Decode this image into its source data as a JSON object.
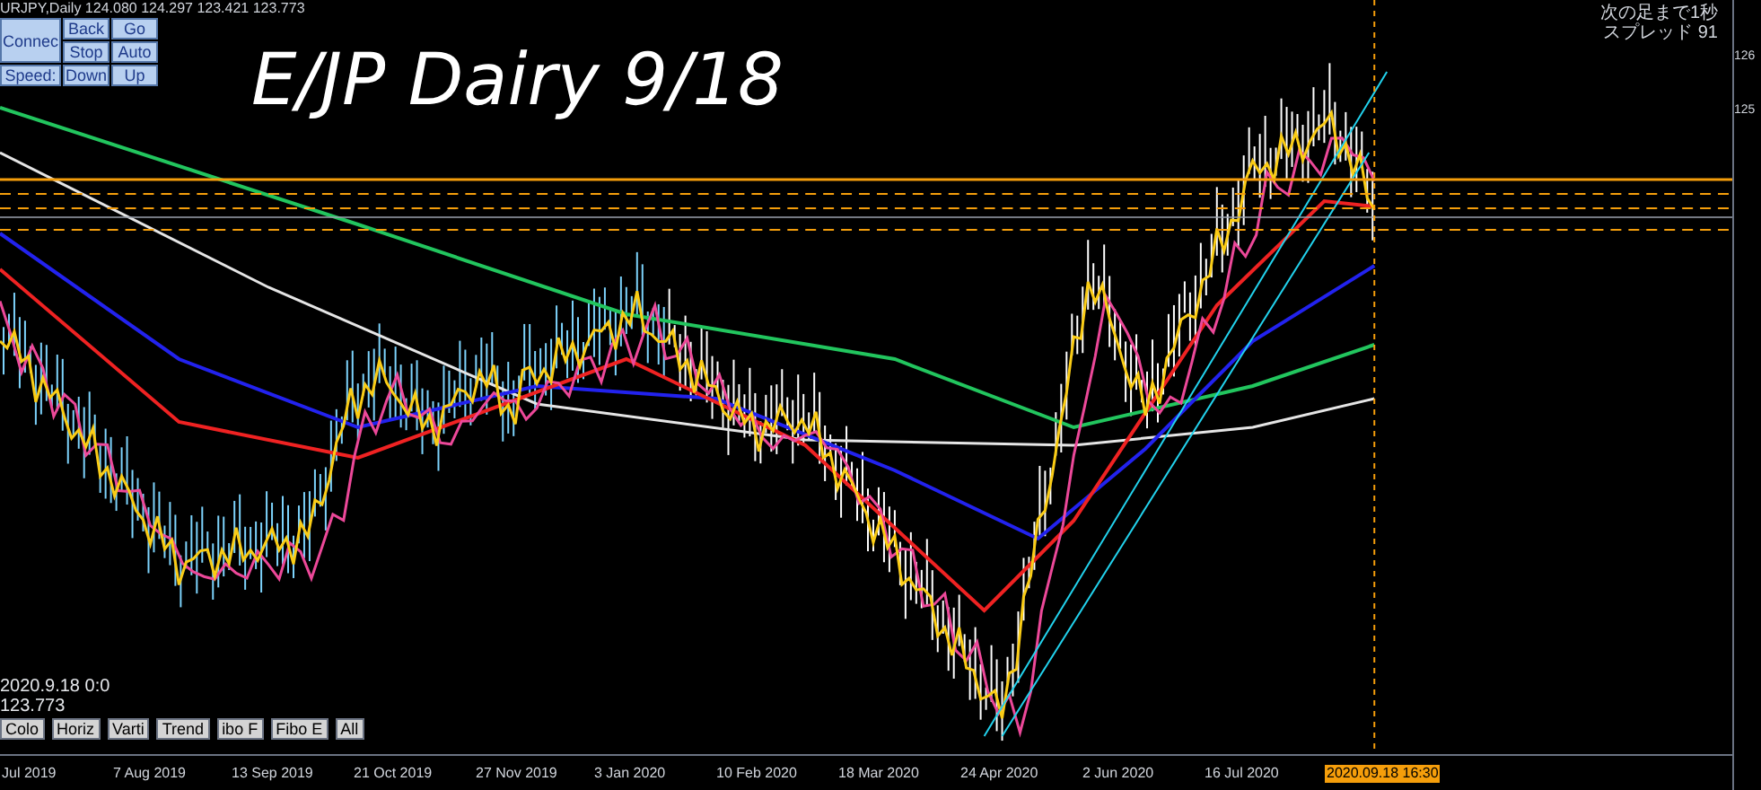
{
  "header": "URJPY,Daily  124.080 124.297 123.421 123.773",
  "replay_buttons": [
    {
      "label": "Connec",
      "kind": "tall"
    },
    {
      "label": "Back",
      "kind": "small"
    },
    {
      "label": "Go",
      "kind": "small"
    },
    {
      "label": "Stop",
      "kind": "small"
    },
    {
      "label": "Auto",
      "kind": "small"
    },
    {
      "label": "Speed:",
      "kind": "small"
    },
    {
      "label": "Down",
      "kind": "small"
    },
    {
      "label": "Up",
      "kind": "small"
    }
  ],
  "note": "E/JP Dairy 9/18",
  "countdown": [
    "次の足まで1秒",
    "スプレッド 91"
  ],
  "price_labels": [
    "126",
    "125"
  ],
  "cursor_info": [
    "2020.9.18 0:0",
    "123.773"
  ],
  "tool_buttons": [
    "Colo",
    "Horiz",
    "Varti",
    "Trend",
    "ibo F",
    "Fibo E",
    "All"
  ],
  "x_labels": [
    {
      "text": "Jul 2019",
      "kind": "date"
    },
    {
      "text": "7 Aug 2019",
      "kind": "date"
    },
    {
      "text": "13 Sep 2019",
      "kind": "date"
    },
    {
      "text": "21 Oct 2019",
      "kind": "date"
    },
    {
      "text": "27 Nov 2019",
      "kind": "date"
    },
    {
      "text": "3 Jan 2020",
      "kind": "date"
    },
    {
      "text": "10 Feb 2020",
      "kind": "date"
    },
    {
      "text": "18 Mar 2020",
      "kind": "date"
    },
    {
      "text": "24 Apr 2020",
      "kind": "date"
    },
    {
      "text": "2 Jun 2020",
      "kind": "date"
    },
    {
      "text": "16 Jul 2020",
      "kind": "date"
    },
    {
      "text": "2020.09.18 16:30",
      "kind": "cursor"
    }
  ]
}
